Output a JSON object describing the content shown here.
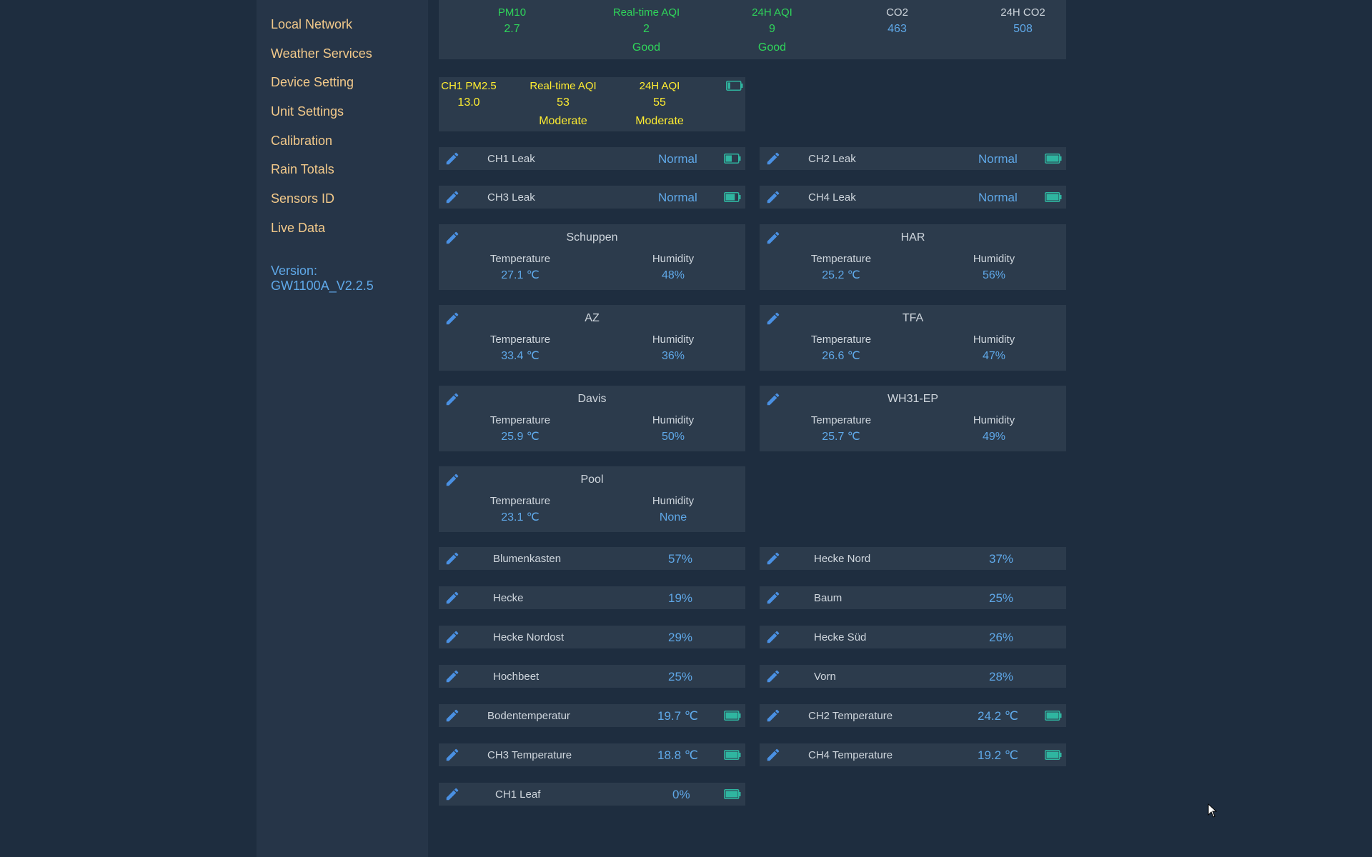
{
  "sidebar": {
    "items": [
      {
        "label": "Local Network"
      },
      {
        "label": "Weather Services"
      },
      {
        "label": "Device Setting"
      },
      {
        "label": "Unit Settings"
      },
      {
        "label": "Calibration"
      },
      {
        "label": "Rain Totals"
      },
      {
        "label": "Sensors ID"
      },
      {
        "label": "Live Data"
      }
    ],
    "version_label": "Version:",
    "version_value": "GW1100A_V2.2.5"
  },
  "air": {
    "pm10_label": "PM10",
    "pm10_value": "2.7",
    "rt_aqi_label": "Real-time AQI",
    "rt_aqi_value": "2",
    "rt_aqi_status": "Good",
    "aqi24_label": "24H AQI",
    "aqi24_value": "9",
    "aqi24_status": "Good",
    "co2_label": "CO2",
    "co2_value": "463",
    "co2_24_label": "24H CO2",
    "co2_24_value": "508"
  },
  "ch1pm": {
    "pm_label": "CH1 PM2.5",
    "pm_value": "13.0",
    "rt_aqi_label": "Real-time AQI",
    "rt_aqi_value": "53",
    "rt_aqi_status": "Moderate",
    "aqi24_label": "24H AQI",
    "aqi24_value": "55",
    "aqi24_status": "Moderate",
    "battery_level": 0.2
  },
  "leaks": [
    {
      "label": "CH1 Leak",
      "value": "Normal",
      "battery_level": 0.5
    },
    {
      "label": "CH2 Leak",
      "value": "Normal",
      "battery_level": 1.0
    },
    {
      "label": "CH3 Leak",
      "value": "Normal",
      "battery_level": 0.75
    },
    {
      "label": "CH4 Leak",
      "value": "Normal",
      "battery_level": 1.0
    }
  ],
  "th_sensors": [
    {
      "name": "Schuppen",
      "temp_label": "Temperature",
      "temp": "27.1 ℃",
      "hum_label": "Humidity",
      "hum": "48%"
    },
    {
      "name": "HAR",
      "temp_label": "Temperature",
      "temp": "25.2 ℃",
      "hum_label": "Humidity",
      "hum": "56%"
    },
    {
      "name": "AZ",
      "temp_label": "Temperature",
      "temp": "33.4 ℃",
      "hum_label": "Humidity",
      "hum": "36%"
    },
    {
      "name": "TFA",
      "temp_label": "Temperature",
      "temp": "26.6 ℃",
      "hum_label": "Humidity",
      "hum": "47%"
    },
    {
      "name": "Davis",
      "temp_label": "Temperature",
      "temp": "25.9 ℃",
      "hum_label": "Humidity",
      "hum": "50%"
    },
    {
      "name": "WH31-EP",
      "temp_label": "Temperature",
      "temp": "25.7 ℃",
      "hum_label": "Humidity",
      "hum": "49%"
    },
    {
      "name": "Pool",
      "temp_label": "Temperature",
      "temp": "23.1 ℃",
      "hum_label": "Humidity",
      "hum": "None"
    }
  ],
  "soil": [
    {
      "label": "Blumenkasten",
      "value": "57%"
    },
    {
      "label": "Hecke Nord",
      "value": "37%"
    },
    {
      "label": "Hecke",
      "value": "19%"
    },
    {
      "label": "Baum",
      "value": "25%"
    },
    {
      "label": "Hecke Nordost",
      "value": "29%"
    },
    {
      "label": "Hecke Süd",
      "value": "26%"
    },
    {
      "label": "Hochbeet",
      "value": "25%"
    },
    {
      "label": "Vorn",
      "value": "28%"
    }
  ],
  "temps": [
    {
      "label": "Bodentemperatur",
      "value": "19.7 ℃",
      "battery_level": 1.0
    },
    {
      "label": "CH2 Temperature",
      "value": "24.2 ℃",
      "battery_level": 1.0
    },
    {
      "label": "CH3 Temperature",
      "value": "18.8 ℃",
      "battery_level": 1.0
    },
    {
      "label": "CH4 Temperature",
      "value": "19.2 ℃",
      "battery_level": 1.0
    }
  ],
  "leaf": {
    "label": "CH1 Leaf",
    "value": "0%",
    "battery_level": 1.0
  },
  "colors": {
    "background": "#1e2d3f",
    "sidebar": "#263548",
    "card": "#2c3b4c",
    "nav_text": "#f2c98a",
    "value_blue": "#5fa8e8",
    "good_green": "#2fd55a",
    "moderate_yellow": "#ffed31",
    "battery_teal": "#2fb5a0"
  }
}
